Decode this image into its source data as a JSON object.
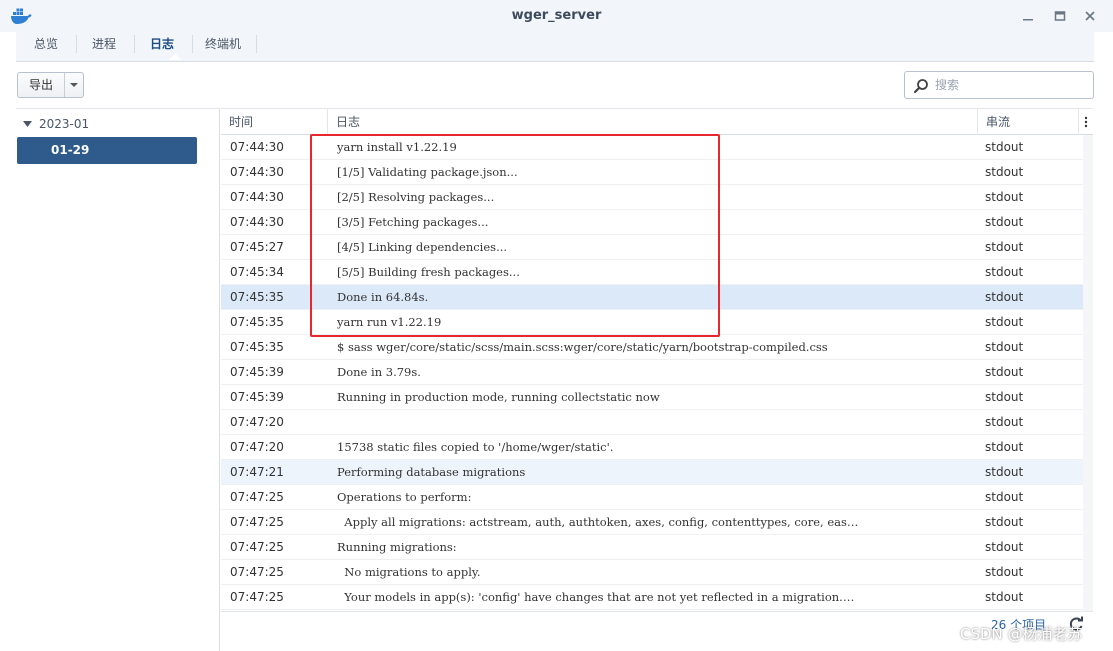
{
  "window": {
    "title": "wger_server",
    "app_icon": "docker-whale-icon"
  },
  "tabs": [
    {
      "label": "总览",
      "active": false
    },
    {
      "label": "进程",
      "active": false
    },
    {
      "label": "日志",
      "active": true
    },
    {
      "label": "终端机",
      "active": false
    }
  ],
  "toolbar": {
    "export_label": "导出",
    "search_placeholder": "搜索"
  },
  "tree": {
    "group_label": "2023-01",
    "selected_item": "01-29"
  },
  "grid": {
    "columns": {
      "time": "时间",
      "log": "日志",
      "stream": "串流"
    },
    "rows": [
      {
        "time": "07:44:30",
        "log": "yarn install v1.22.19",
        "stream": "stdout"
      },
      {
        "time": "07:44:30",
        "log": "[1/5] Validating package.json...",
        "stream": "stdout"
      },
      {
        "time": "07:44:30",
        "log": "[2/5] Resolving packages...",
        "stream": "stdout"
      },
      {
        "time": "07:44:30",
        "log": "[3/5] Fetching packages...",
        "stream": "stdout"
      },
      {
        "time": "07:45:27",
        "log": "[4/5] Linking dependencies...",
        "stream": "stdout"
      },
      {
        "time": "07:45:34",
        "log": "[5/5] Building fresh packages...",
        "stream": "stdout"
      },
      {
        "time": "07:45:35",
        "log": "Done in 64.84s.",
        "stream": "stdout"
      },
      {
        "time": "07:45:35",
        "log": "yarn run v1.22.19",
        "stream": "stdout"
      },
      {
        "time": "07:45:35",
        "log": "$ sass wger/core/static/scss/main.scss:wger/core/static/yarn/bootstrap-compiled.css",
        "stream": "stdout"
      },
      {
        "time": "07:45:39",
        "log": "Done in 3.79s.",
        "stream": "stdout"
      },
      {
        "time": "07:45:39",
        "log": "Running in production mode, running collectstatic now",
        "stream": "stdout"
      },
      {
        "time": "07:47:20",
        "log": "",
        "stream": "stdout"
      },
      {
        "time": "07:47:20",
        "log": "15738 static files copied to '/home/wger/static'.",
        "stream": "stdout"
      },
      {
        "time": "07:47:21",
        "log": "Performing database migrations",
        "stream": "stdout"
      },
      {
        "time": "07:47:25",
        "log": "Operations to perform:",
        "stream": "stdout"
      },
      {
        "time": "07:47:25",
        "log": "  Apply all migrations: actstream, auth, authtoken, axes, config, contenttypes, core, eas…",
        "stream": "stdout"
      },
      {
        "time": "07:47:25",
        "log": "Running migrations:",
        "stream": "stdout"
      },
      {
        "time": "07:47:25",
        "log": "  No migrations to apply.",
        "stream": "stdout"
      },
      {
        "time": "07:47:25",
        "log": "  Your models in app(s): 'config' have changes that are not yet reflected in a migration.…",
        "stream": "stdout"
      }
    ],
    "selected_row_index": 6,
    "hover_row_index": 13
  },
  "footer": {
    "item_count": "26 个项目"
  },
  "watermark": "CSDN @杨浦老苏",
  "colors": {
    "accent": "#2b63a8",
    "selected_tree": "#2f5a8c",
    "row_selected": "#dce9f8",
    "annotation_box": "#e8262e"
  }
}
